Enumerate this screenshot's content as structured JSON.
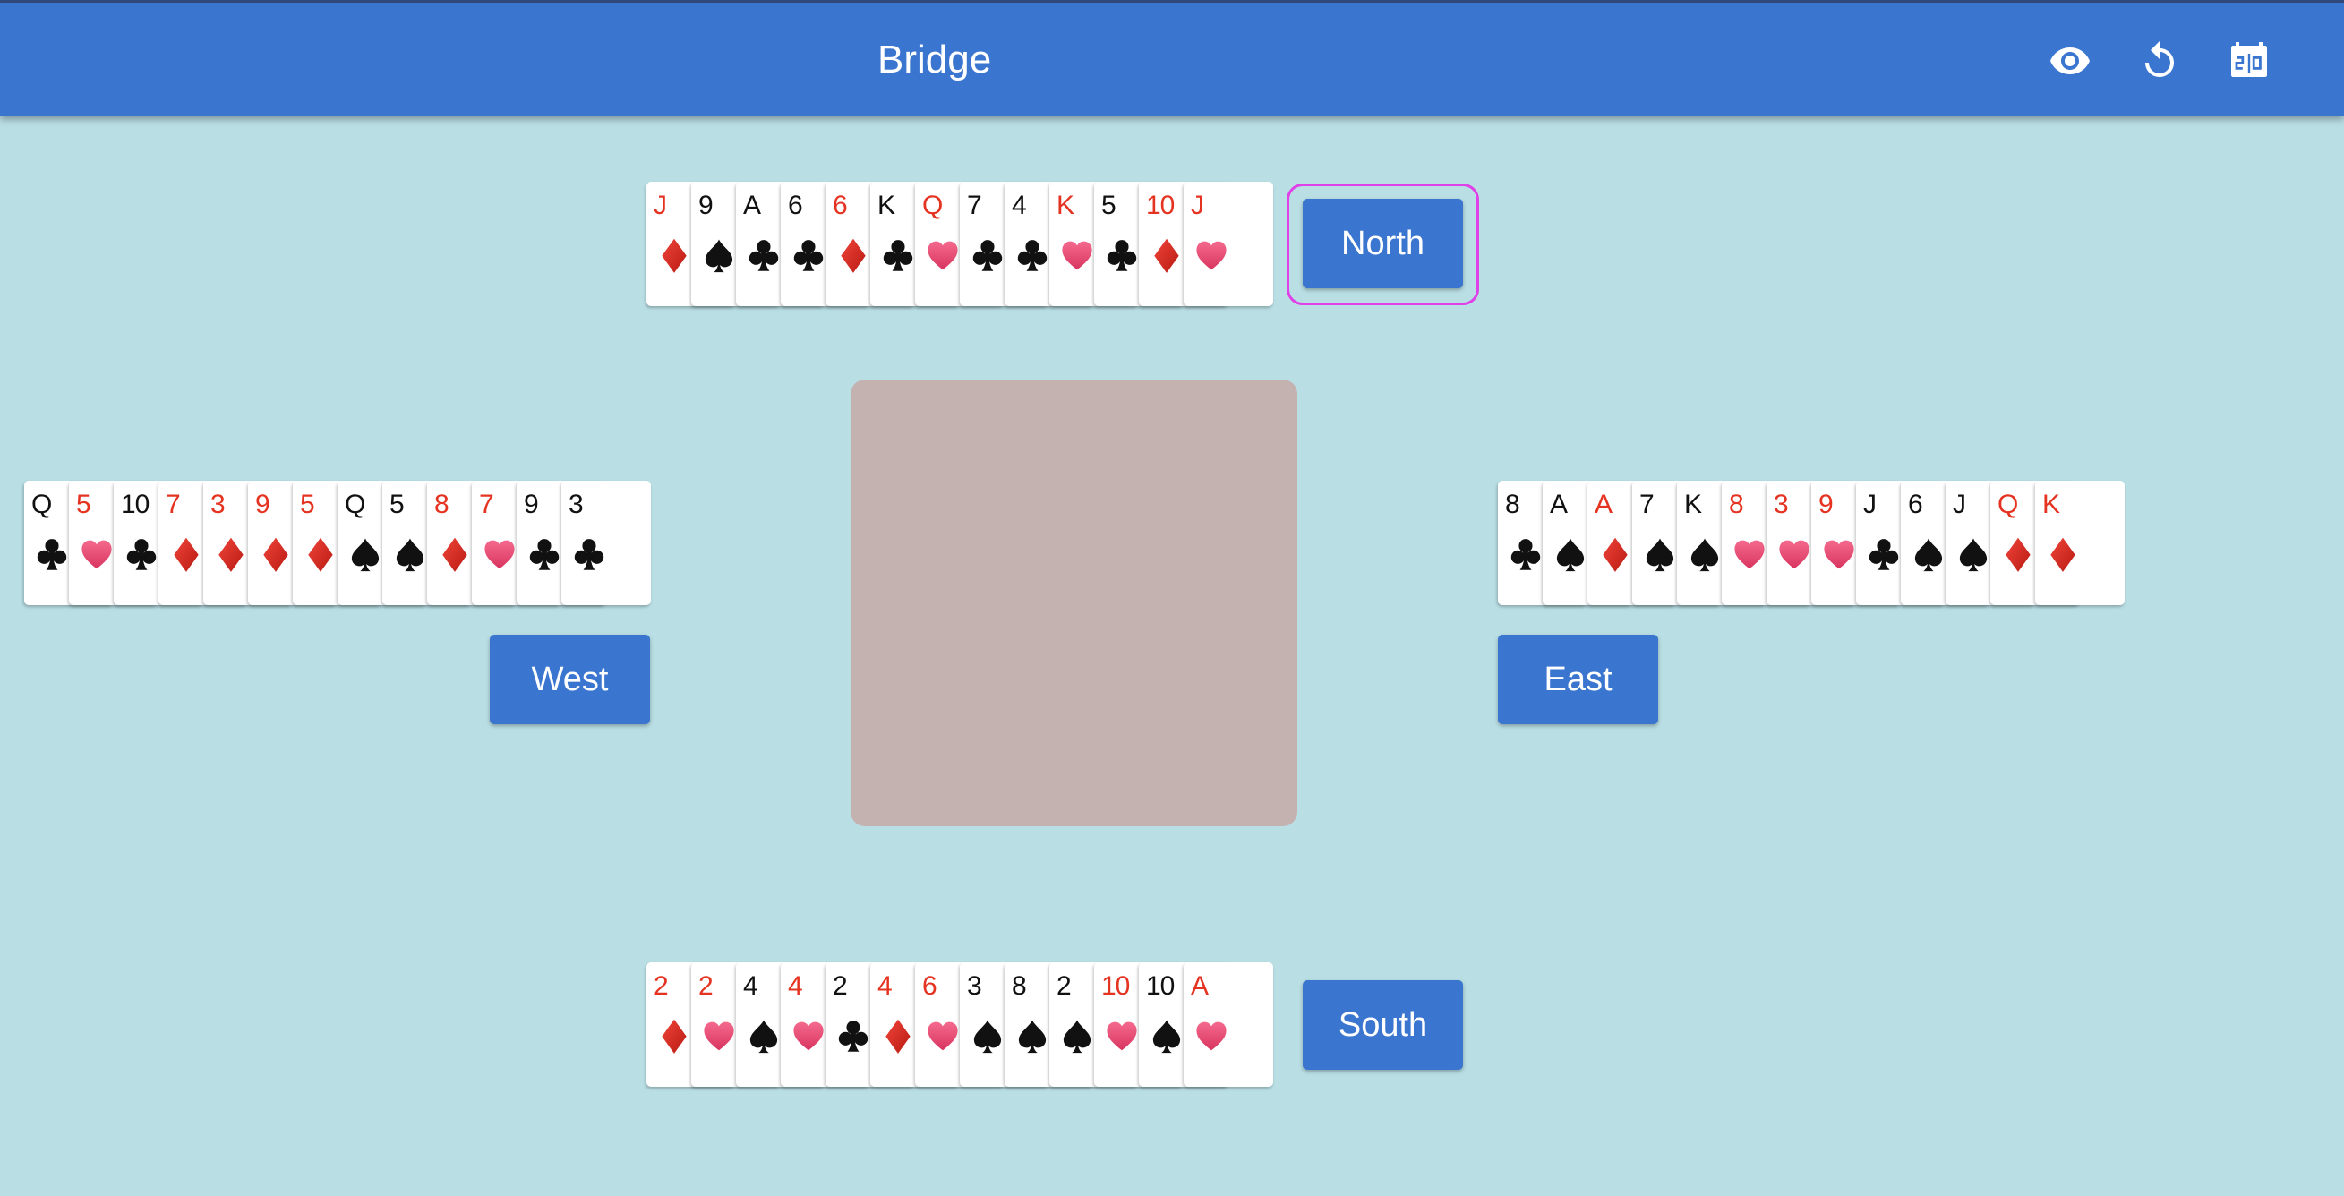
{
  "app": {
    "title": "Bridge",
    "toolbar_icons": [
      "eye-icon",
      "refresh-icon",
      "scoreboard-icon"
    ]
  },
  "colors": {
    "topbar": "#3a76d0",
    "background": "#b9dfe5",
    "table": "#c4b2b1",
    "red_suit": "#e53322",
    "focus_ring": "#e040e8"
  },
  "hands": {
    "north": {
      "button_label": "North",
      "cards": [
        {
          "rank": "J",
          "suit": "diamonds"
        },
        {
          "rank": "9",
          "suit": "spades"
        },
        {
          "rank": "A",
          "suit": "clubs"
        },
        {
          "rank": "6",
          "suit": "clubs"
        },
        {
          "rank": "6",
          "suit": "diamonds"
        },
        {
          "rank": "K",
          "suit": "clubs"
        },
        {
          "rank": "Q",
          "suit": "hearts"
        },
        {
          "rank": "7",
          "suit": "clubs"
        },
        {
          "rank": "4",
          "suit": "clubs"
        },
        {
          "rank": "K",
          "suit": "hearts"
        },
        {
          "rank": "5",
          "suit": "clubs"
        },
        {
          "rank": "10",
          "suit": "diamonds"
        },
        {
          "rank": "J",
          "suit": "hearts"
        }
      ]
    },
    "west": {
      "button_label": "West",
      "cards": [
        {
          "rank": "Q",
          "suit": "clubs"
        },
        {
          "rank": "5",
          "suit": "hearts"
        },
        {
          "rank": "10",
          "suit": "clubs"
        },
        {
          "rank": "7",
          "suit": "diamonds"
        },
        {
          "rank": "3",
          "suit": "diamonds"
        },
        {
          "rank": "9",
          "suit": "diamonds"
        },
        {
          "rank": "5",
          "suit": "diamonds"
        },
        {
          "rank": "Q",
          "suit": "spades"
        },
        {
          "rank": "5",
          "suit": "spades"
        },
        {
          "rank": "8",
          "suit": "diamonds"
        },
        {
          "rank": "7",
          "suit": "hearts"
        },
        {
          "rank": "9",
          "suit": "clubs"
        },
        {
          "rank": "3",
          "suit": "clubs"
        }
      ]
    },
    "east": {
      "button_label": "East",
      "cards": [
        {
          "rank": "8",
          "suit": "clubs"
        },
        {
          "rank": "A",
          "suit": "spades"
        },
        {
          "rank": "A",
          "suit": "diamonds"
        },
        {
          "rank": "7",
          "suit": "spades"
        },
        {
          "rank": "K",
          "suit": "spades"
        },
        {
          "rank": "8",
          "suit": "hearts"
        },
        {
          "rank": "3",
          "suit": "hearts"
        },
        {
          "rank": "9",
          "suit": "hearts"
        },
        {
          "rank": "J",
          "suit": "clubs"
        },
        {
          "rank": "6",
          "suit": "spades"
        },
        {
          "rank": "J",
          "suit": "spades"
        },
        {
          "rank": "Q",
          "suit": "diamonds"
        },
        {
          "rank": "K",
          "suit": "diamonds"
        }
      ]
    },
    "south": {
      "button_label": "South",
      "cards": [
        {
          "rank": "2",
          "suit": "diamonds"
        },
        {
          "rank": "2",
          "suit": "hearts"
        },
        {
          "rank": "4",
          "suit": "spades"
        },
        {
          "rank": "4",
          "suit": "hearts"
        },
        {
          "rank": "2",
          "suit": "clubs"
        },
        {
          "rank": "4",
          "suit": "diamonds"
        },
        {
          "rank": "6",
          "suit": "hearts"
        },
        {
          "rank": "3",
          "suit": "spades"
        },
        {
          "rank": "8",
          "suit": "spades"
        },
        {
          "rank": "2",
          "suit": "spades"
        },
        {
          "rank": "10",
          "suit": "hearts"
        },
        {
          "rank": "10",
          "suit": "spades"
        },
        {
          "rank": "A",
          "suit": "hearts"
        }
      ]
    }
  }
}
